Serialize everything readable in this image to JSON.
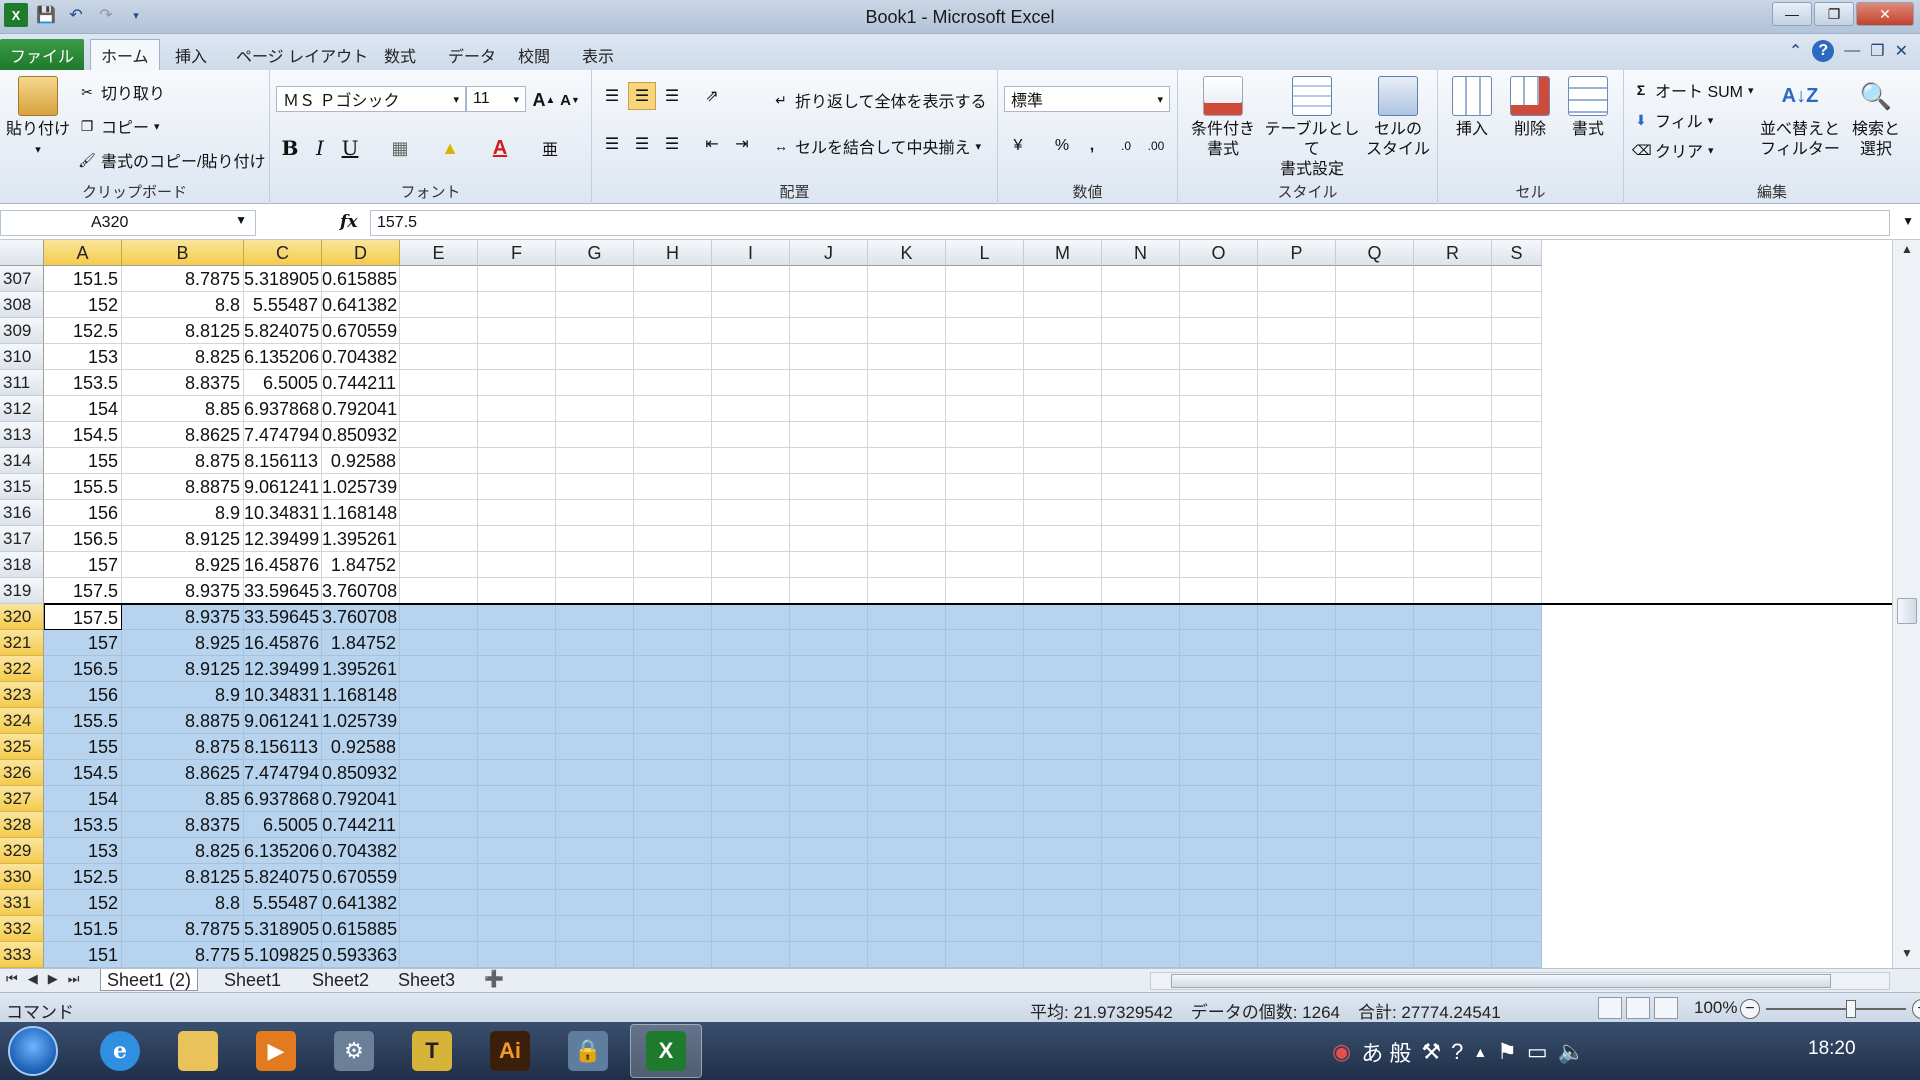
{
  "window": {
    "title": "Book1 - Microsoft Excel"
  },
  "qat": {
    "icons": [
      "excel-logo-icon",
      "save-icon",
      "undo-icon",
      "redo-icon",
      "customize-qat-icon"
    ]
  },
  "tabs": [
    "ファイル",
    "ホーム",
    "挿入",
    "ページ レイアウト",
    "数式",
    "データ",
    "校閲",
    "表示"
  ],
  "ribbon": {
    "clipboard": {
      "label": "クリップボード",
      "paste": "貼り付け",
      "cut": "切り取り",
      "copy": "コピー",
      "format_painter": "書式のコピー/貼り付け"
    },
    "font": {
      "label": "フォント",
      "font_name": "ＭＳ Ｐゴシック",
      "font_size": "11"
    },
    "alignment": {
      "label": "配置",
      "wrap": "折り返して全体を表示する",
      "merge": "セルを結合して中央揃え"
    },
    "number": {
      "label": "数値",
      "format": "標準"
    },
    "styles": {
      "label": "スタイル",
      "conditional": [
        "条件付き",
        "書式"
      ],
      "table": [
        "テーブルとして",
        "書式設定"
      ],
      "cell": [
        "セルの",
        "スタイル"
      ]
    },
    "cells": {
      "label": "セル",
      "insert": "挿入",
      "delete": "削除",
      "format": "書式"
    },
    "editing": {
      "label": "編集",
      "autosum": "オート SUM",
      "fill": "フィル",
      "clear": "クリア",
      "sort": [
        "並べ替えと",
        "フィルター"
      ],
      "find": [
        "検索と",
        "選択"
      ]
    }
  },
  "formula_bar": {
    "name_box": "A320",
    "formula": "157.5"
  },
  "columns": [
    "A",
    "B",
    "C",
    "D",
    "E",
    "F",
    "G",
    "H",
    "I",
    "J",
    "K",
    "L",
    "M",
    "N",
    "O",
    "P",
    "Q",
    "R",
    "S"
  ],
  "rows": [
    {
      "n": "307",
      "a": "151.5",
      "b": "8.7875",
      "c": "5.318905",
      "d": "0.615885"
    },
    {
      "n": "308",
      "a": "152",
      "b": "8.8",
      "c": "5.55487",
      "d": "0.641382"
    },
    {
      "n": "309",
      "a": "152.5",
      "b": "8.8125",
      "c": "5.824075",
      "d": "0.670559"
    },
    {
      "n": "310",
      "a": "153",
      "b": "8.825",
      "c": "6.135206",
      "d": "0.704382"
    },
    {
      "n": "311",
      "a": "153.5",
      "b": "8.8375",
      "c": "6.5005",
      "d": "0.744211"
    },
    {
      "n": "312",
      "a": "154",
      "b": "8.85",
      "c": "6.937868",
      "d": "0.792041"
    },
    {
      "n": "313",
      "a": "154.5",
      "b": "8.8625",
      "c": "7.474794",
      "d": "0.850932"
    },
    {
      "n": "314",
      "a": "155",
      "b": "8.875",
      "c": "8.156113",
      "d": "0.92588"
    },
    {
      "n": "315",
      "a": "155.5",
      "b": "8.8875",
      "c": "9.061241",
      "d": "1.025739"
    },
    {
      "n": "316",
      "a": "156",
      "b": "8.9",
      "c": "10.34831",
      "d": "1.168148"
    },
    {
      "n": "317",
      "a": "156.5",
      "b": "8.9125",
      "c": "12.39499",
      "d": "1.395261"
    },
    {
      "n": "318",
      "a": "157",
      "b": "8.925",
      "c": "16.45876",
      "d": "1.84752"
    },
    {
      "n": "319",
      "a": "157.5",
      "b": "8.9375",
      "c": "33.59645",
      "d": "3.760708"
    },
    {
      "n": "320",
      "a": "157.5",
      "b": "8.9375",
      "c": "33.59645",
      "d": "3.760708"
    },
    {
      "n": "321",
      "a": "157",
      "b": "8.925",
      "c": "16.45876",
      "d": "1.84752"
    },
    {
      "n": "322",
      "a": "156.5",
      "b": "8.9125",
      "c": "12.39499",
      "d": "1.395261"
    },
    {
      "n": "323",
      "a": "156",
      "b": "8.9",
      "c": "10.34831",
      "d": "1.168148"
    },
    {
      "n": "324",
      "a": "155.5",
      "b": "8.8875",
      "c": "9.061241",
      "d": "1.025739"
    },
    {
      "n": "325",
      "a": "155",
      "b": "8.875",
      "c": "8.156113",
      "d": "0.92588"
    },
    {
      "n": "326",
      "a": "154.5",
      "b": "8.8625",
      "c": "7.474794",
      "d": "0.850932"
    },
    {
      "n": "327",
      "a": "154",
      "b": "8.85",
      "c": "6.937868",
      "d": "0.792041"
    },
    {
      "n": "328",
      "a": "153.5",
      "b": "8.8375",
      "c": "6.5005",
      "d": "0.744211"
    },
    {
      "n": "329",
      "a": "153",
      "b": "8.825",
      "c": "6.135206",
      "d": "0.704382"
    },
    {
      "n": "330",
      "a": "152.5",
      "b": "8.8125",
      "c": "5.824075",
      "d": "0.670559"
    },
    {
      "n": "331",
      "a": "152",
      "b": "8.8",
      "c": "5.55487",
      "d": "0.641382"
    },
    {
      "n": "332",
      "a": "151.5",
      "b": "8.7875",
      "c": "5.318905",
      "d": "0.615885"
    },
    {
      "n": "333",
      "a": "151",
      "b": "8.775",
      "c": "5.109825",
      "d": "0.593363"
    }
  ],
  "sheets": [
    "Sheet1 (2)",
    "Sheet1",
    "Sheet2",
    "Sheet3"
  ],
  "status": {
    "mode": "コマンド",
    "average": "平均: 21.97329542",
    "count": "データの個数: 1264",
    "sum": "合計: 27774.24541",
    "zoom": "100%"
  },
  "taskbar": {
    "time": "18:20",
    "ime": "あ 般"
  }
}
